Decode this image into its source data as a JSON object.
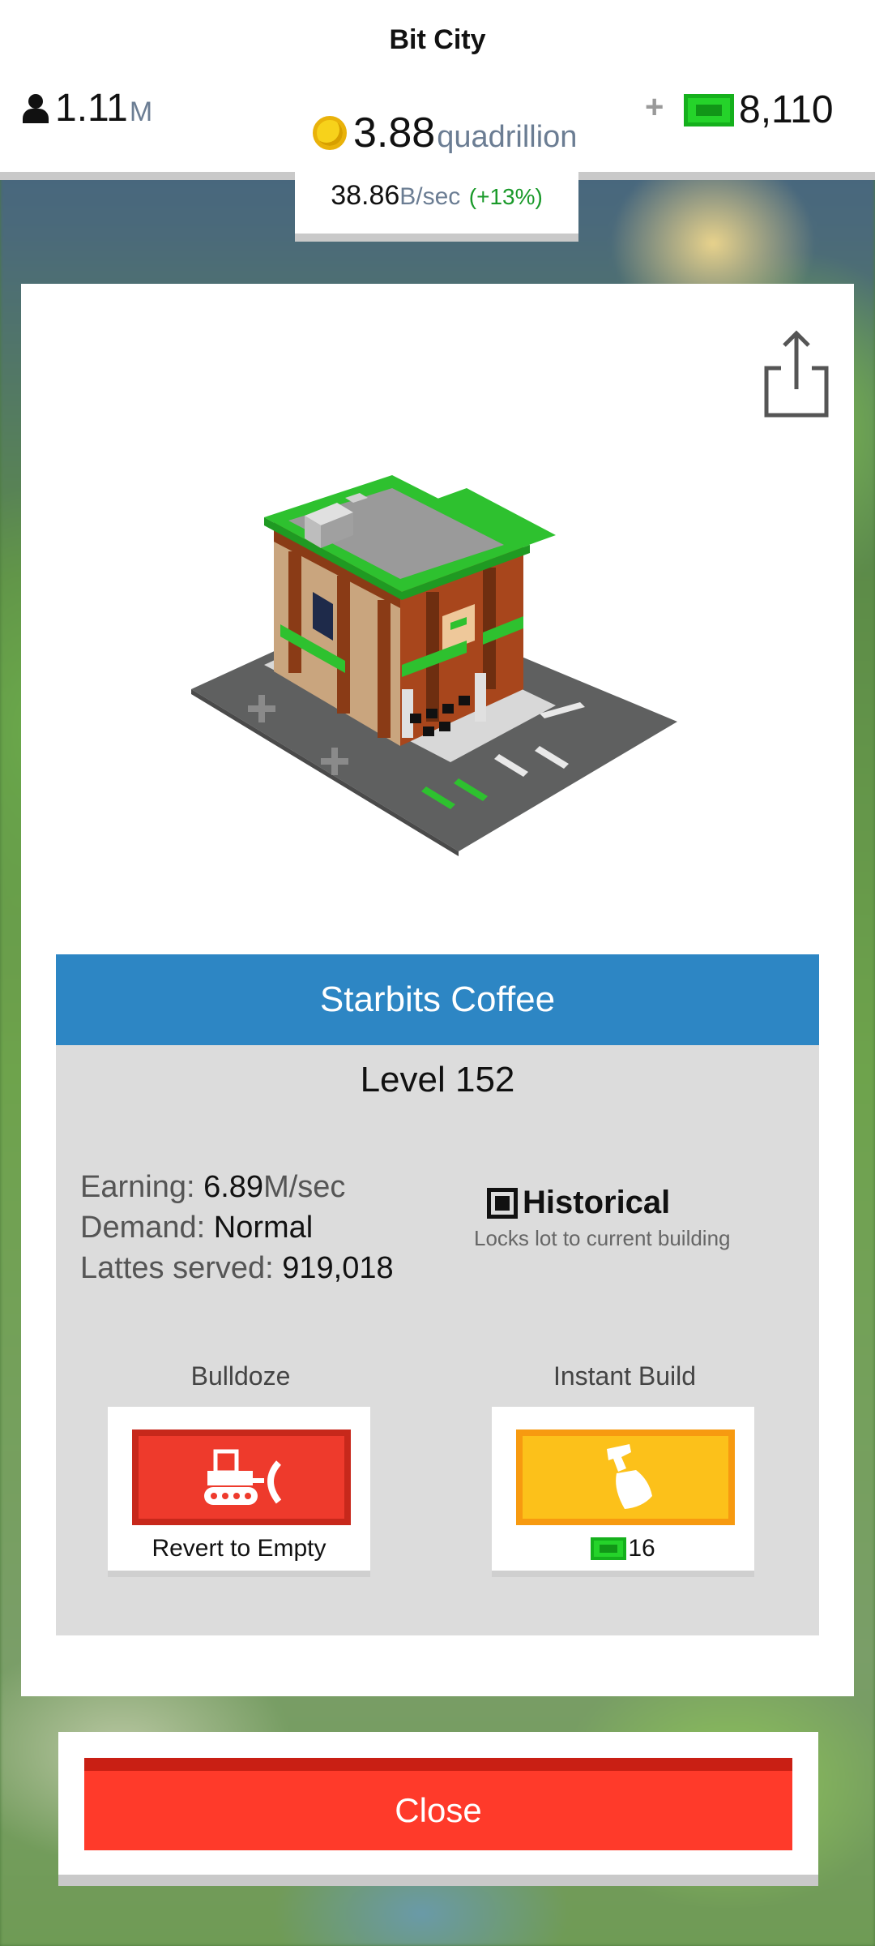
{
  "app": {
    "title": "Bit City"
  },
  "header": {
    "population": {
      "value": "1.11",
      "unit": "M",
      "icon": "person-icon"
    },
    "coins": {
      "value": "3.88",
      "unit": "quadrillion",
      "icon": "coin-icon"
    },
    "plus": "+",
    "bux": {
      "value": "8,110",
      "icon": "bux-icon"
    },
    "rate": {
      "value": "38.86",
      "unit": "B/sec",
      "change": "(+13%)"
    }
  },
  "building": {
    "name": "Starbits Coffee",
    "level": "Level 152",
    "stats": [
      {
        "key": "Earning: ",
        "value": "6.89",
        "unit": "M/sec"
      },
      {
        "key": "Demand: ",
        "value": "Normal",
        "unit": ""
      },
      {
        "key": "Lattes served: ",
        "value": "919,018",
        "unit": ""
      }
    ],
    "historical": {
      "title": "Historical",
      "subtitle": "Locks lot to current building",
      "checked": true
    }
  },
  "actions": {
    "bulldoze": {
      "label": "Bulldoze",
      "caption": "Revert to Empty",
      "icon": "bulldozer-icon"
    },
    "instant_build": {
      "label": "Instant Build",
      "cost": "16",
      "icon": "hammer-icon"
    }
  },
  "close_label": "Close",
  "colors": {
    "accent_blue": "#2d86c4",
    "danger_red": "#ee3a2c",
    "build_yellow": "#fcc11a",
    "bux_green": "#25d32a"
  }
}
